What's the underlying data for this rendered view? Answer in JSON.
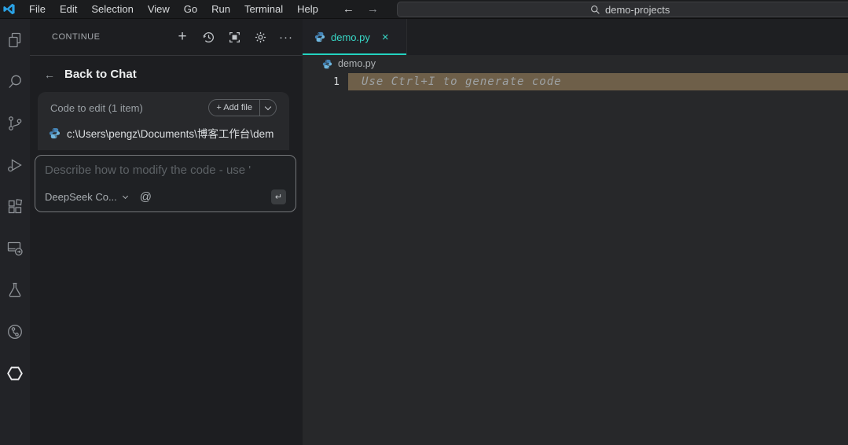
{
  "titlebar": {
    "menus": [
      "File",
      "Edit",
      "Selection",
      "View",
      "Go",
      "Run",
      "Terminal",
      "Help"
    ],
    "back_arrow": "←",
    "forward_arrow": "→",
    "search_text": "demo-projects"
  },
  "activity_bar": {
    "items": [
      "explorer",
      "search",
      "source-control",
      "run-and-debug",
      "extensions",
      "remote-explorer",
      "testing",
      "gitlens",
      "continue-extension"
    ]
  },
  "sidebar": {
    "title": "CONTINUE",
    "header_icons": {
      "plus": "+",
      "ellipsis": "···"
    },
    "back_arrow": "←",
    "back_label": "Back to Chat",
    "code_to_edit": {
      "label": "Code to edit (1 item)",
      "add_file_label": "+ Add file",
      "file_path": "c:\\Users\\pengz\\Documents\\博客工作台\\dem"
    },
    "input": {
      "placeholder": "Describe how to modify the code - use '",
      "model_selected": "DeepSeek Co...",
      "at_symbol": "@",
      "enter_hint": "↵"
    }
  },
  "editor": {
    "tab": {
      "label": "demo.py",
      "close": "×"
    },
    "breadcrumb": "demo.py",
    "line_number": "1",
    "ghost_text": "Use Ctrl+I to generate code"
  },
  "colors": {
    "accent_teal": "#23d3c0",
    "line_highlight": "#6e5f49",
    "python_blue": "#4584b6",
    "python_light_blue": "#6fb7e0",
    "editor_bg": "#27282a",
    "sidebar_bg": "#1d1e21"
  }
}
